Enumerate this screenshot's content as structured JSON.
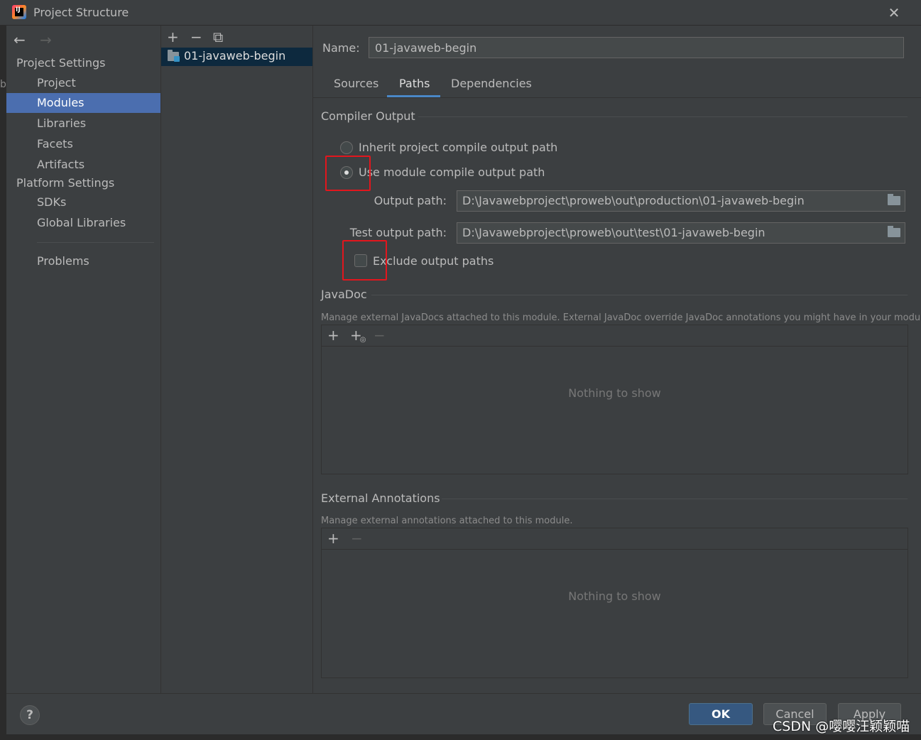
{
  "window": {
    "title": "Project Structure",
    "close_glyph": "✕",
    "app_icon_letters": "IJ"
  },
  "left_edge_char": "b",
  "sidebar": {
    "back_glyph": "←",
    "forward_glyph": "→",
    "project_settings_heading": "Project Settings",
    "project_items": [
      "Project",
      "Modules",
      "Libraries",
      "Facets",
      "Artifacts"
    ],
    "selected_item": "Modules",
    "platform_settings_heading": "Platform Settings",
    "platform_items": [
      "SDKs",
      "Global Libraries"
    ],
    "problems": "Problems"
  },
  "modules_list": {
    "add_glyph": "+",
    "remove_glyph": "−",
    "copy_glyph": "⧉",
    "items": [
      "01-javaweb-begin"
    ]
  },
  "main": {
    "name_label": "Name:",
    "name_value": "01-javaweb-begin",
    "tabs": [
      "Sources",
      "Paths",
      "Dependencies"
    ],
    "active_tab": "Paths",
    "compiler_output": {
      "title": "Compiler Output",
      "inherit_label": "Inherit project compile output path",
      "use_module_label": "Use module compile output path",
      "selected": "use_module",
      "output_path_label": "Output path:",
      "output_path_value": "D:\\Javawebproject\\proweb\\out\\production\\01-javaweb-begin",
      "test_output_path_label": "Test output path:",
      "test_output_path_value": "D:\\Javawebproject\\proweb\\out\\test\\01-javaweb-begin",
      "exclude_label": "Exclude output paths",
      "exclude_checked": false
    },
    "javadoc": {
      "title": "JavaDoc",
      "description": "Manage external JavaDocs attached to this module. External JavaDoc override JavaDoc annotations you might have in your module.",
      "add_glyph": "+",
      "add_url_glyph": "+",
      "remove_glyph": "−",
      "empty_text": "Nothing to show"
    },
    "external_annotations": {
      "title": "External Annotations",
      "description": "Manage external annotations attached to this module.",
      "add_glyph": "+",
      "remove_glyph": "−",
      "empty_text": "Nothing to show"
    }
  },
  "footer": {
    "help_glyph": "?",
    "ok_label": "OK",
    "cancel_label": "Cancel",
    "apply_label": "Apply"
  },
  "watermark": "CSDN @嘤嘤汪颖颖喵",
  "colors": {
    "background": "#3c3f41",
    "selection": "#4b6eaf",
    "primary_button": "#365880",
    "tab_underline": "#4a88c7",
    "annotation_red": "#e2161d"
  }
}
